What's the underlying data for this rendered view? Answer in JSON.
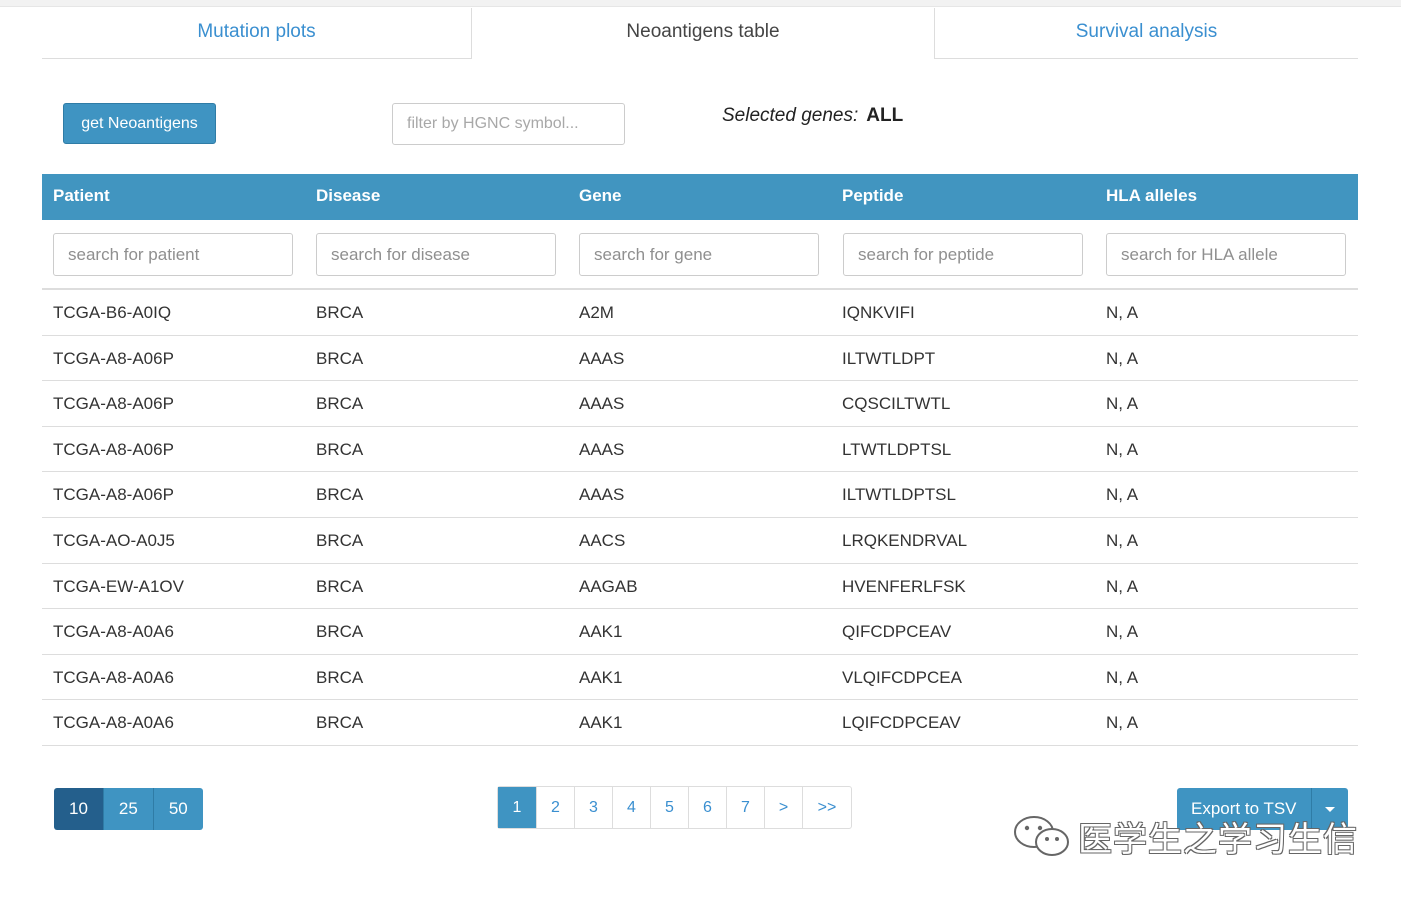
{
  "tabs": [
    {
      "label": "Mutation plots"
    },
    {
      "label": "Neoantigens table"
    },
    {
      "label": "Survival analysis"
    }
  ],
  "controls": {
    "get_button": "get Neoantigens",
    "filter_placeholder": "filter by HGNC symbol...",
    "selected_label": "Selected genes:",
    "selected_value": "ALL"
  },
  "table": {
    "columns": [
      "Patient",
      "Disease",
      "Gene",
      "Peptide",
      "HLA alleles"
    ],
    "search_placeholders": [
      "search for patient",
      "search for disease",
      "search for gene",
      "search for peptide",
      "search for HLA allele"
    ],
    "rows": [
      [
        "TCGA-B6-A0IQ",
        "BRCA",
        "A2M",
        "IQNKVIFI",
        "N, A"
      ],
      [
        "TCGA-A8-A06P",
        "BRCA",
        "AAAS",
        "ILTWTLDPT",
        "N, A"
      ],
      [
        "TCGA-A8-A06P",
        "BRCA",
        "AAAS",
        "CQSCILTWTL",
        "N, A"
      ],
      [
        "TCGA-A8-A06P",
        "BRCA",
        "AAAS",
        "LTWTLDPTSL",
        "N, A"
      ],
      [
        "TCGA-A8-A06P",
        "BRCA",
        "AAAS",
        "ILTWTLDPTSL",
        "N, A"
      ],
      [
        "TCGA-AO-A0J5",
        "BRCA",
        "AACS",
        "LRQKENDRVAL",
        "N, A"
      ],
      [
        "TCGA-EW-A1OV",
        "BRCA",
        "AAGAB",
        "HVENFERLFSK",
        "N, A"
      ],
      [
        "TCGA-A8-A0A6",
        "BRCA",
        "AAK1",
        "QIFCDPCEAV",
        "N, A"
      ],
      [
        "TCGA-A8-A0A6",
        "BRCA",
        "AAK1",
        "VLQIFCDPCEA",
        "N, A"
      ],
      [
        "TCGA-A8-A0A6",
        "BRCA",
        "AAK1",
        "LQIFCDPCEAV",
        "N, A"
      ]
    ]
  },
  "page_length": {
    "options": [
      "10",
      "25",
      "50"
    ],
    "selected": "10"
  },
  "pagination": {
    "pages": [
      "1",
      "2",
      "3",
      "4",
      "5",
      "6",
      "7",
      ">",
      ">>"
    ],
    "current": "1"
  },
  "export": {
    "label": "Export to TSV"
  },
  "watermark": {
    "text": "医学生之学习生信",
    "icon": "wechat-icon"
  },
  "colors": {
    "accent": "#3f94c2",
    "header_bg": "#4195c0",
    "active_dark": "#245f8c",
    "link": "#3a8fd0"
  }
}
